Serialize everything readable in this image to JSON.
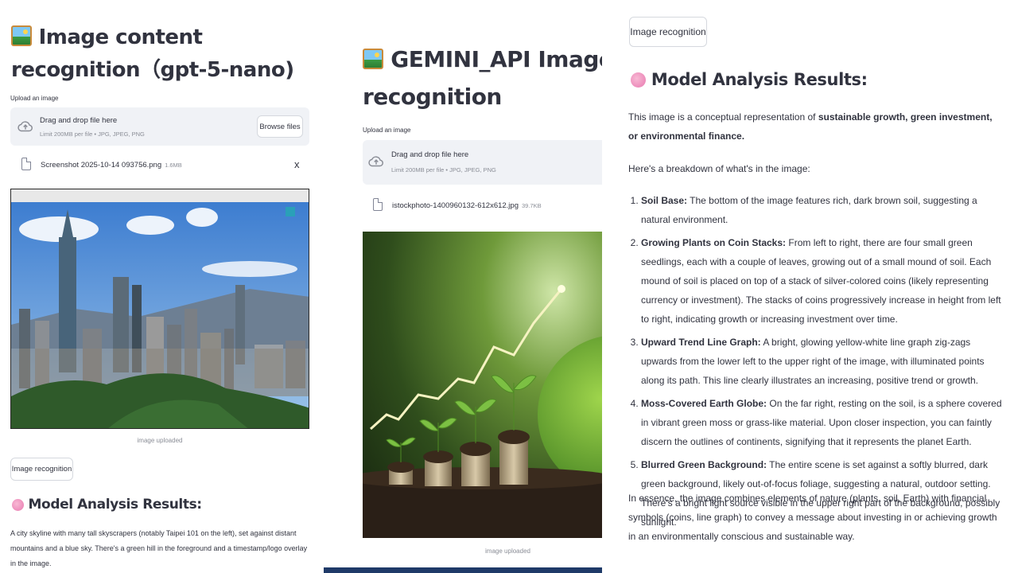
{
  "left": {
    "title": "Image content recognition（gpt-5-nano)",
    "upload_label": "Upload an image",
    "dropzone": {
      "title": "Drag and drop file here",
      "limit": "Limit 200MB per file • JPG, JPEG, PNG",
      "browse": "Browse files"
    },
    "file": {
      "name": "Screenshot 2025-10-14 093756.png",
      "size": "1.6MB",
      "close": "x"
    },
    "image_caption": "image uploaded",
    "recognize_button": "Image recognition",
    "results_title": "Model Analysis Results:",
    "result_text": "A city skyline with many tall skyscrapers (notably Taipei 101 on the left), set against distant mountains and a blue sky. There's a green hill in the foreground and a timestamp/logo overlay in the image."
  },
  "middle": {
    "title_line1": "GEMINI_API Image content",
    "title_line2": "recognition",
    "upload_label": "Upload an image",
    "dropzone": {
      "title": "Drag and drop file here",
      "limit": "Limit 200MB per file • JPG, JPEG, PNG"
    },
    "file": {
      "name": "istockphoto-1400960132-612x612.jpg",
      "size": "39.7KB"
    },
    "image_caption": "image uploaded"
  },
  "right": {
    "recognize_button": "Image recognition",
    "results_title": "Model Analysis Results:",
    "intro_prefix": "This image is a conceptual representation of ",
    "intro_bold": "sustainable growth, green investment, or environmental finance.",
    "breakdown": "Here's a breakdown of what's in the image:",
    "items": [
      {
        "head": "Soil Base:",
        "text": " The bottom of the image features rich, dark brown soil, suggesting a natural environment."
      },
      {
        "head": "Growing Plants on Coin Stacks:",
        "text": " From left to right, there are four small green seedlings, each with a couple of leaves, growing out of a small mound of soil. Each mound of soil is placed on top of a stack of silver-colored coins (likely representing currency or investment). The stacks of coins progressively increase in height from left to right, indicating growth or increasing investment over time."
      },
      {
        "head": "Upward Trend Line Graph:",
        "text": " A bright, glowing yellow-white line graph zig-zags upwards from the lower left to the upper right of the image, with illuminated points along its path. This line clearly illustrates an increasing, positive trend or growth."
      },
      {
        "head": "Moss-Covered Earth Globe:",
        "text": " On the far right, resting on the soil, is a sphere covered in vibrant green moss or grass-like material. Upon closer inspection, you can faintly discern the outlines of continents, signifying that it represents the planet Earth."
      },
      {
        "head": "Blurred Green Background:",
        "text": " The entire scene is set against a softly blurred, dark green background, likely out-of-focus foliage, suggesting a natural, outdoor setting. There's a bright light source visible in the upper right part of the background, possibly sunlight."
      }
    ],
    "summary": "In essence, the image combines elements of nature (plants, soil, Earth) with financial symbols (coins, line graph) to convey a message about investing in or achieving growth in an environmentally conscious and sustainable way."
  },
  "colors": {
    "text": "#31333f",
    "muted": "#8a8d96",
    "dropzone_bg": "#f0f2f6",
    "bottom_bar": "#1f3a68"
  },
  "icons": [
    "picture-emoji-icon",
    "cloud-upload-icon",
    "file-icon",
    "close-icon",
    "brain-emoji-icon"
  ]
}
